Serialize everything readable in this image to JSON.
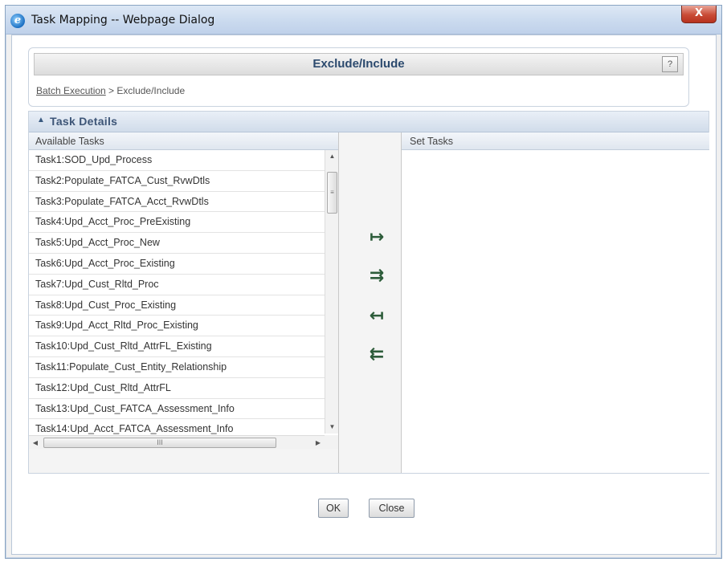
{
  "window": {
    "title": "Task Mapping -- Webpage Dialog",
    "close_glyph": "X"
  },
  "header": {
    "title": "Exclude/Include",
    "help_icon": "help-icon",
    "breadcrumb": {
      "link": "Batch Execution",
      "separator": " > ",
      "current": "Exclude/Include"
    }
  },
  "details": {
    "title": "Task Details",
    "collapse_glyph": "«"
  },
  "available": {
    "header": "Available Tasks",
    "tasks": [
      "Task1:SOD_Upd_Process",
      "Task2:Populate_FATCA_Cust_RvwDtls",
      "Task3:Populate_FATCA_Acct_RvwDtls",
      "Task4:Upd_Acct_Proc_PreExisting",
      "Task5:Upd_Acct_Proc_New",
      "Task6:Upd_Acct_Proc_Existing",
      "Task7:Upd_Cust_Rltd_Proc",
      "Task8:Upd_Cust_Proc_Existing",
      "Task9:Upd_Acct_Rltd_Proc_Existing",
      "Task10:Upd_Cust_Rltd_AttrFL_Existing",
      "Task11:Populate_Cust_Entity_Relationship",
      "Task12:Upd_Cust_Rltd_AttrFL",
      "Task13:Upd_Cust_FATCA_Assessment_Info",
      "Task14:Upd_Acct_FATCA_Assessment_Info"
    ]
  },
  "set": {
    "header": "Set Tasks"
  },
  "movers": {
    "move_right": "↦",
    "move_all_right": "⇉",
    "move_left": "↤",
    "move_all_left": "⇇"
  },
  "buttons": {
    "ok": "OK",
    "close": "Close"
  },
  "colors": {
    "accent": "#2c4a6e",
    "header_bg": "#d1dcea"
  }
}
